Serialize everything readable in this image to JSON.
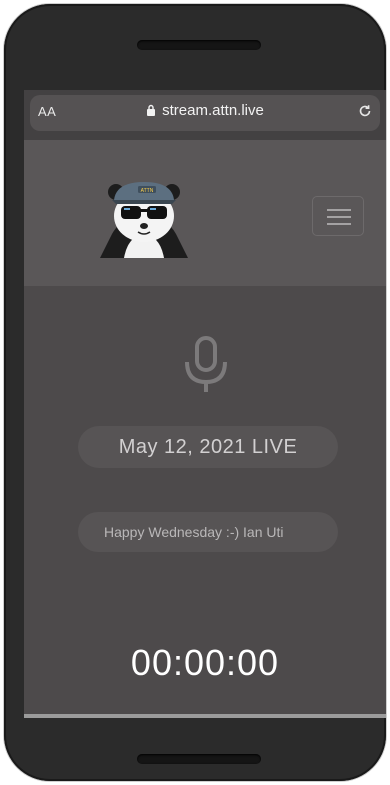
{
  "browser": {
    "text_size_label": "AA",
    "url": "stream.attn.live"
  },
  "header": {
    "logo_text": "ATTN",
    "menu_icon": "hamburger-icon"
  },
  "main": {
    "mic_icon": "microphone-icon",
    "date_label": "May 12, 2021 LIVE",
    "message": "Happy Wednesday :-) Ian Uti",
    "timer": "00:00:00"
  },
  "colors": {
    "screen_bg": "#4d4a4b",
    "header_bg": "#5a5758",
    "pill_bg": "#575455"
  }
}
